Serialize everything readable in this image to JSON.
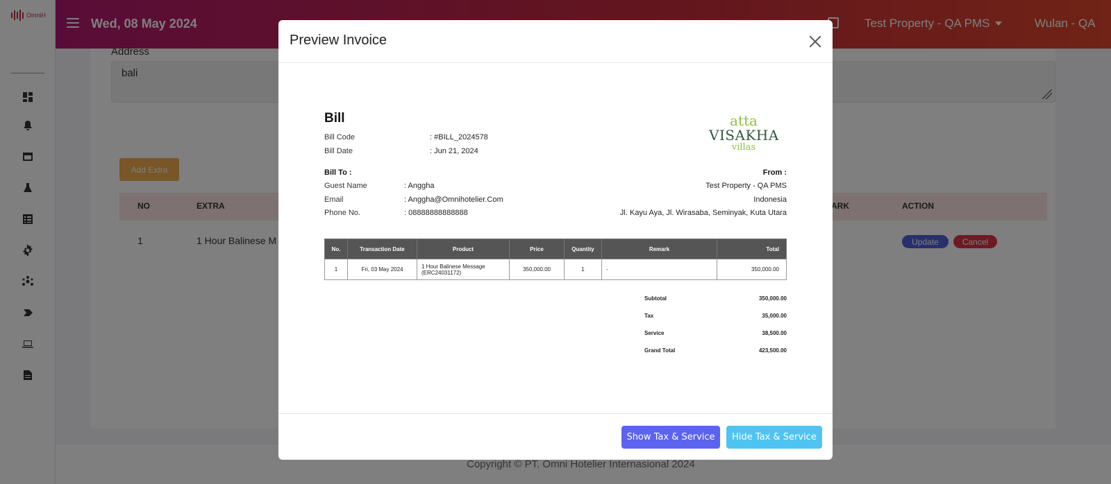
{
  "app": {
    "logo_text": "OmniH",
    "date": "Wed, 08 May 2024",
    "property": "Test Property - QA PMS",
    "user": "Wulan - QA"
  },
  "sidebar": {
    "icons": [
      "dashboard-icon",
      "bell-icon",
      "window-icon",
      "flask-icon",
      "list-icon",
      "gear-icon",
      "network-icon",
      "tag-icon",
      "laptop-icon",
      "document-icon"
    ]
  },
  "page": {
    "address_label": "Address",
    "address_value": "bali",
    "add_extra_label": "Add Extra",
    "extra_table": {
      "headers": [
        "NO",
        "EXTRA",
        "ARK",
        "ACTION"
      ],
      "rows": [
        {
          "no": "1",
          "extra": "1 Hour Balinese M"
        }
      ]
    },
    "update_label": "Update",
    "cancel_label": "Cancel",
    "footer": "Copyright © PT. Omni Hotelier Internasional 2024"
  },
  "modal": {
    "title": "Preview Invoice",
    "show_tax_label": "Show Tax & Service",
    "hide_tax_label": "Hide Tax & Service"
  },
  "invoice": {
    "title": "Bill",
    "bill_code_label": "Bill Code",
    "bill_code": ": #BILL_2024578",
    "bill_date_label": "Bill Date",
    "bill_date": ": Jun 21, 2024",
    "brand": {
      "line1": "atta",
      "line2": "VISAKHA",
      "line3": "villas"
    },
    "bill_to_label": "Bill To :",
    "guest_name_label": "Guest Name",
    "guest_name": ": Anggha",
    "email_label": "Email",
    "email": ": Anggha@Omnihotelier.Com",
    "phone_label": "Phone No.",
    "phone": ": 08888888888888",
    "from_label": "From :",
    "from_name": "Test Property - QA PMS",
    "from_country": "Indonesia",
    "from_address": "Jl. Kayu Aya, Jl. Wirasaba, Seminyak, Kuta Utara",
    "table_headers": [
      "No.",
      "Transaction Date",
      "Product",
      "Price",
      "Quantity",
      "Remark",
      "Total"
    ],
    "table_rows": [
      {
        "no": "1",
        "date": "Fri, 03 May 2024",
        "product_line1": "1 Hour Balinese Message",
        "product_line2": "(ERC24031172)",
        "price": "350,000.00",
        "qty": "1",
        "remark": "-",
        "total": "350,000.00"
      }
    ],
    "subtotal_label": "Subtotal",
    "subtotal": "350,000.00",
    "tax_label": "Tax",
    "tax": "35,000.00",
    "service_label": "Service",
    "service": "38,500.00",
    "grand_total_label": "Grand Total",
    "grand_total": "423,500.00"
  }
}
